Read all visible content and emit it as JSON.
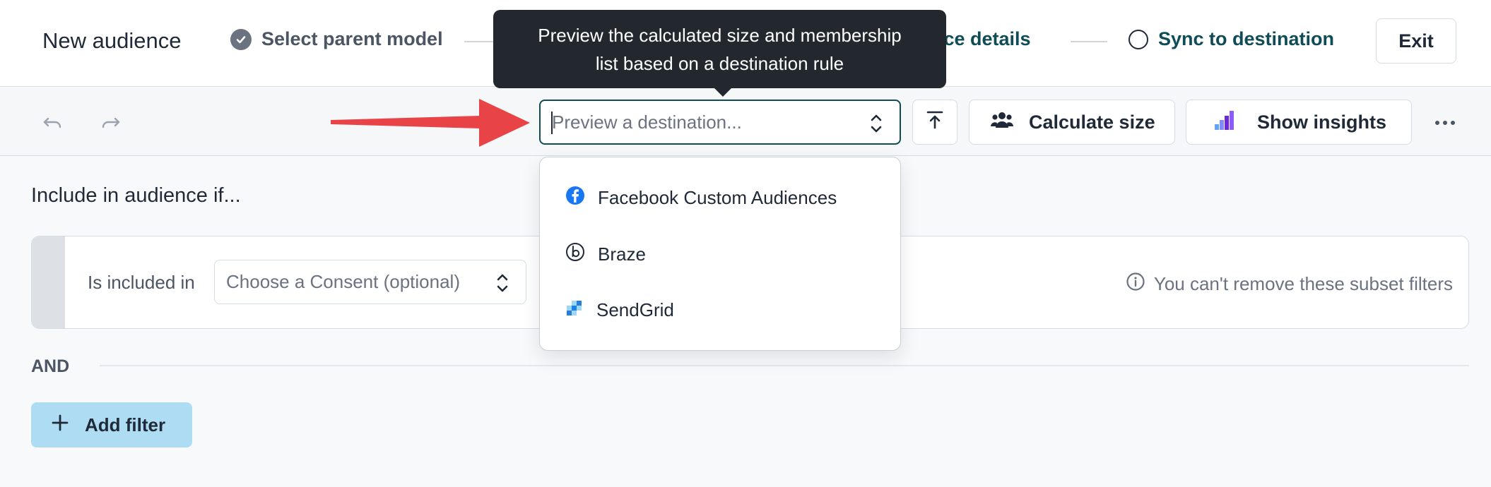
{
  "header": {
    "title": "New audience",
    "steps": [
      {
        "label": "Select parent model",
        "status": "done"
      },
      {
        "label": "ence details",
        "status": "active"
      },
      {
        "label": "Sync to destination",
        "status": "todo"
      }
    ],
    "exit_label": "Exit"
  },
  "toolbar": {
    "destination_placeholder": "Preview a destination...",
    "calculate_label": "Calculate size",
    "insights_label": "Show insights"
  },
  "tooltip": {
    "line1": "Preview the calculated size and membership",
    "line2": "list based on a destination rule"
  },
  "dropdown": {
    "options": [
      {
        "label": "Facebook Custom Audiences",
        "icon": "facebook-icon"
      },
      {
        "label": "Braze",
        "icon": "braze-icon"
      },
      {
        "label": "SendGrid",
        "icon": "sendgrid-icon"
      }
    ]
  },
  "content": {
    "section_title": "Include in audience if...",
    "filter": {
      "label": "Is included in",
      "consent_placeholder": "Choose a Consent (optional)",
      "note": "You can't remove these subset filters"
    },
    "and_label": "AND",
    "add_filter_label": "Add filter"
  },
  "colors": {
    "accent": "#0f4c56",
    "tooltip_bg": "#22282e",
    "add_filter_bg": "#aedcf3",
    "annotation_arrow": "#e84448",
    "facebook": "#1877f2"
  }
}
